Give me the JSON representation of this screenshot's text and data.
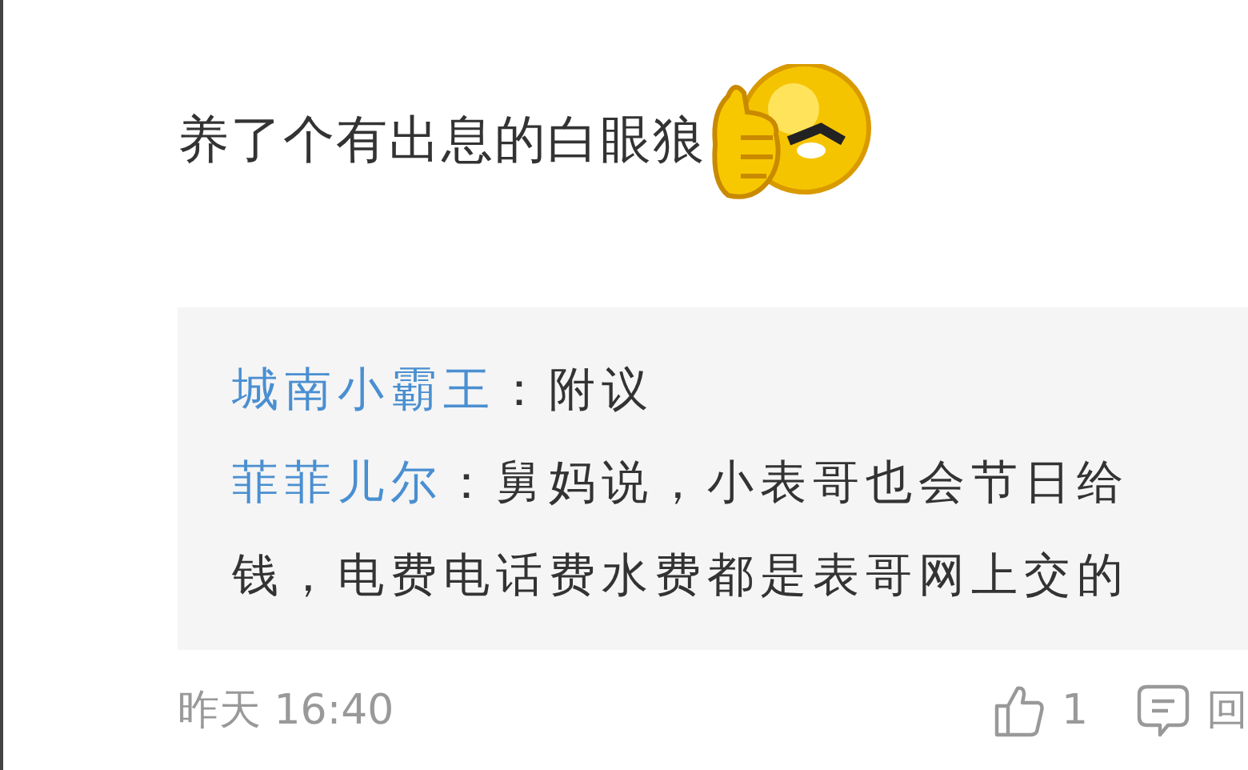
{
  "comment": {
    "text": "养了个有出息的白眼狼"
  },
  "replies": [
    {
      "author": "城南小霸王",
      "text": "：附议"
    },
    {
      "author": "菲菲儿尔",
      "text": "：舅妈说，小表哥也会节日给钱，电费电话费水费都是表哥网上交的"
    }
  ],
  "footer": {
    "time": "昨天 16:40",
    "likes": "1",
    "reply": "回"
  }
}
